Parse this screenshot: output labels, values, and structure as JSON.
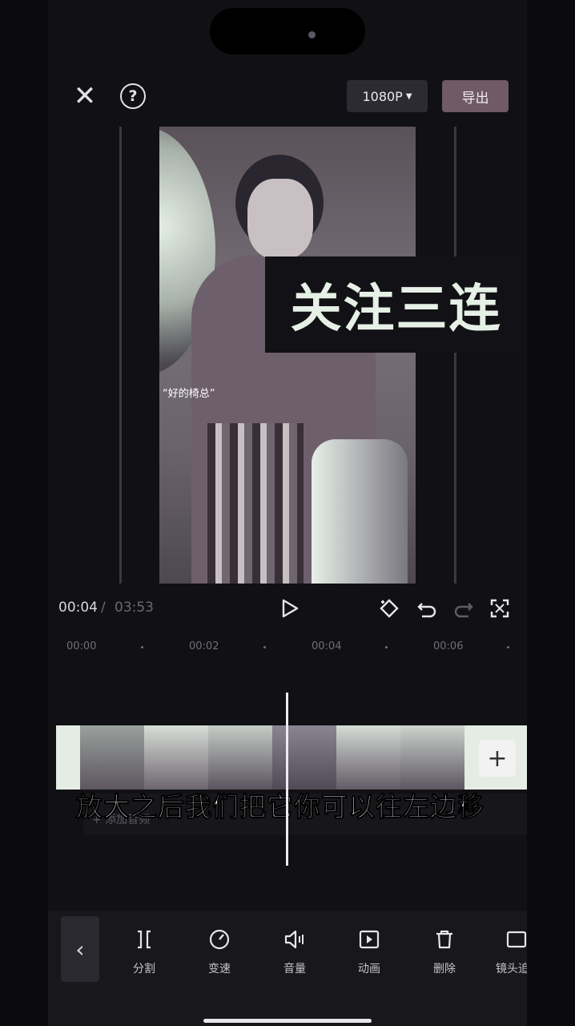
{
  "toolbar": {
    "close_icon": "close-icon",
    "help_icon": "help-icon",
    "resolution": "1080P",
    "export_label": "导出"
  },
  "preview": {
    "video_caption": "“好的椅总”",
    "overlay_text": "关注三连"
  },
  "playback": {
    "current_time": "00:04",
    "separator": "/",
    "total_time": "03:53"
  },
  "ruler": {
    "labels": [
      "00:00",
      "00:02",
      "00:04",
      "00:06"
    ]
  },
  "timeline": {
    "subtitle": "放大之后我们把它你可以往左边移",
    "audio_label": "+ 添加音频"
  },
  "bottom_toolbar": {
    "items": [
      {
        "icon": "split-icon",
        "label": "分割"
      },
      {
        "icon": "speed-icon",
        "label": "变速"
      },
      {
        "icon": "volume-icon",
        "label": "音量"
      },
      {
        "icon": "animation-icon",
        "label": "动画"
      },
      {
        "icon": "delete-icon",
        "label": "删除"
      },
      {
        "icon": "camera-track-icon",
        "label": "镜头追"
      }
    ]
  }
}
